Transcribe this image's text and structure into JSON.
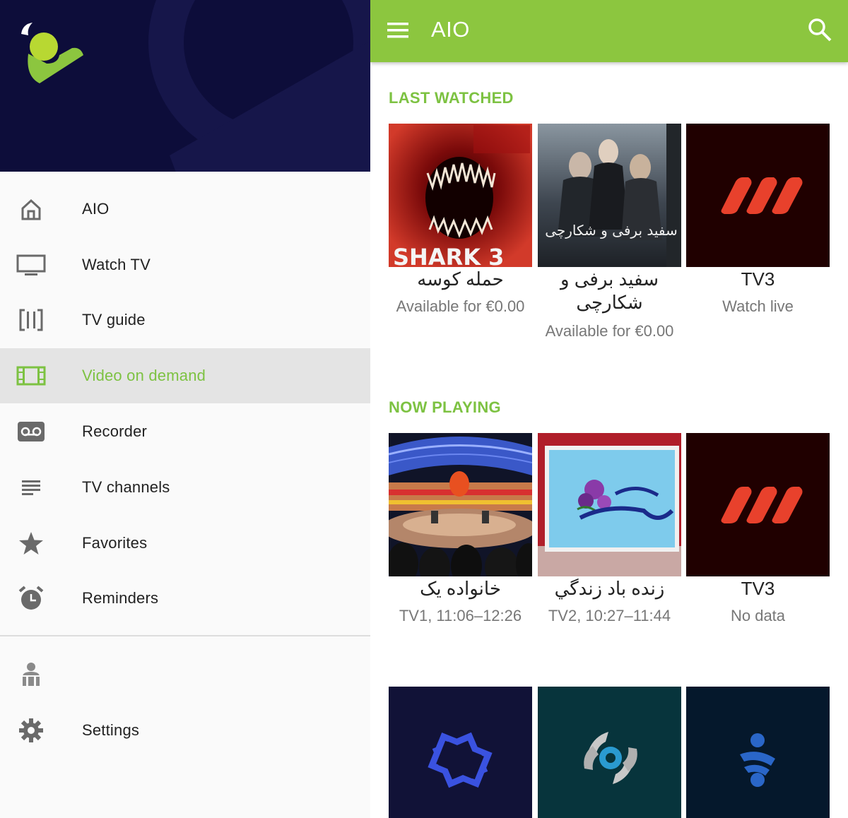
{
  "drawer": {
    "items": [
      {
        "label": "AIO",
        "icon": "home-icon",
        "active": false
      },
      {
        "label": "Watch TV",
        "icon": "tv-icon",
        "active": false
      },
      {
        "label": "TV guide",
        "icon": "tv-guide-icon",
        "active": false
      },
      {
        "label": "Video on demand",
        "icon": "film-icon",
        "active": true
      },
      {
        "label": "Recorder",
        "icon": "voicemail-icon",
        "active": false
      },
      {
        "label": "TV channels",
        "icon": "list-icon",
        "active": false
      },
      {
        "label": "Favorites",
        "icon": "star-icon",
        "active": false
      },
      {
        "label": "Reminders",
        "icon": "alarm-clock-icon",
        "active": false
      }
    ],
    "profile_icon": "user-icon",
    "settings": {
      "label": "Settings",
      "icon": "gear-icon"
    }
  },
  "appbar": {
    "title": "AIO",
    "menu_icon": "menu-icon",
    "search_icon": "search-icon"
  },
  "sections": {
    "last_watched": {
      "title": "LAST WATCHED",
      "cards": [
        {
          "title": "حمله کوسه",
          "subtitle": "Available for €0.00",
          "poster_text": "SHARK 3"
        },
        {
          "title": "سفید برفی و شکارچی",
          "subtitle": "Available for €0.00",
          "poster_text": "سفید برفی و شکارچی"
        },
        {
          "title": "TV3",
          "subtitle": "Watch live"
        }
      ]
    },
    "now_playing": {
      "title": "NOW PLAYING",
      "cards": [
        {
          "title": "خانواده یک",
          "subtitle": "TV1, 11:06–12:26"
        },
        {
          "title": "زنده باد زندگي",
          "subtitle": "TV2, 10:27–11:44"
        },
        {
          "title": "TV3",
          "subtitle": "No data"
        }
      ]
    }
  },
  "colors": {
    "accent": "#8cc63f",
    "accent_text": "#7dc242",
    "drawer_header": "#0d0d3a"
  }
}
